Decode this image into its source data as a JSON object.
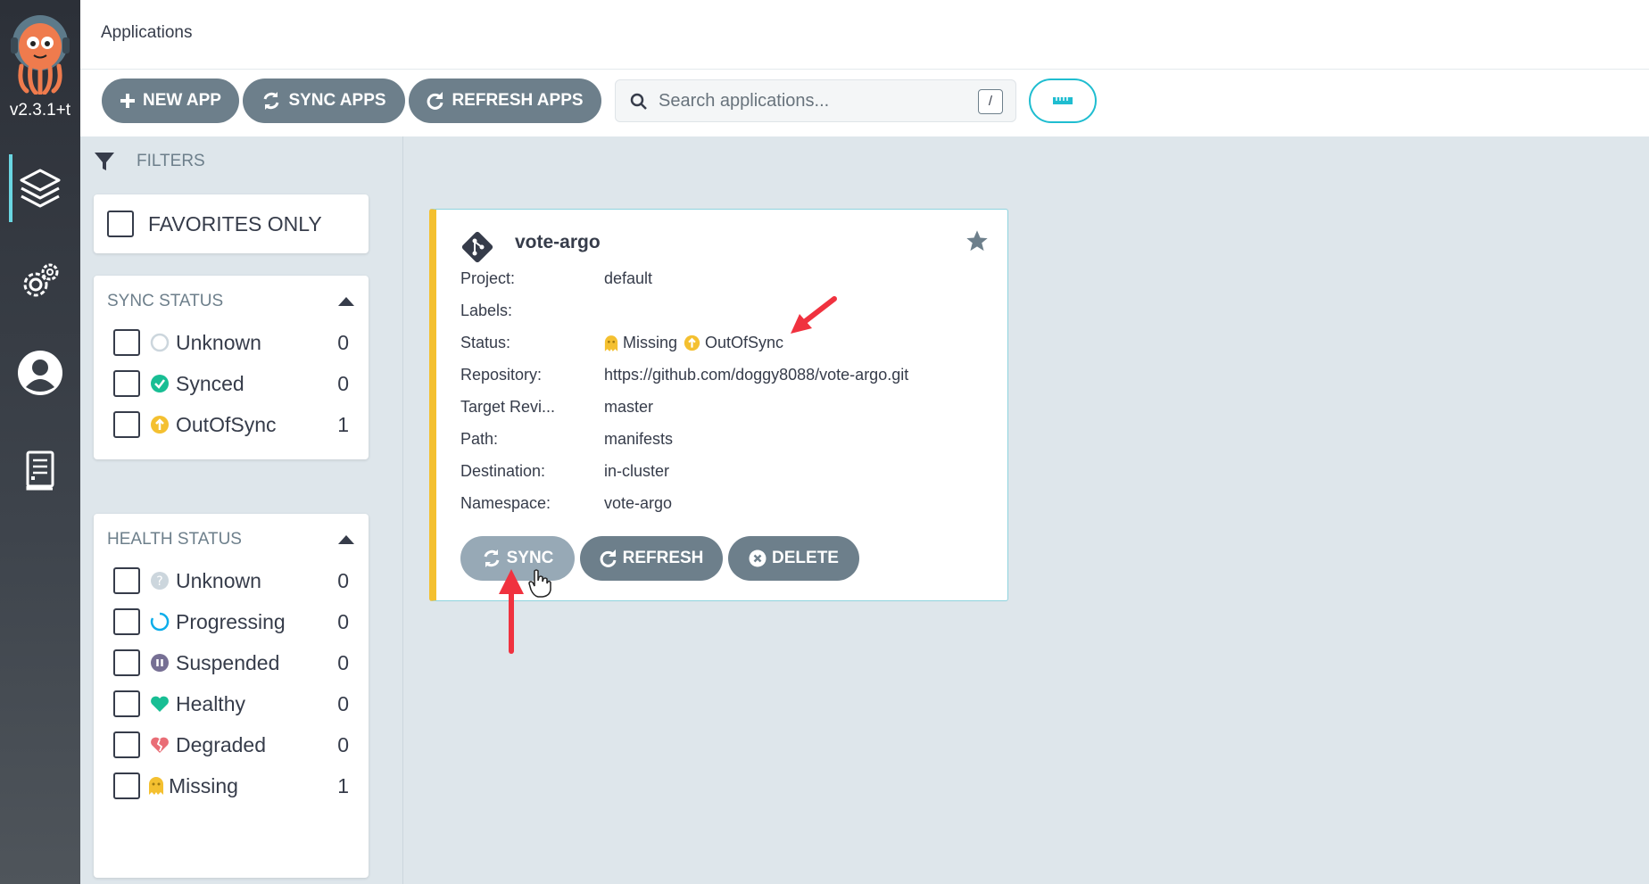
{
  "nav": {
    "version": "v2.3.1+t"
  },
  "header": {
    "title": "Applications"
  },
  "toolbar": {
    "new_app": "NEW APP",
    "sync_apps": "SYNC APPS",
    "refresh_apps": "REFRESH APPS",
    "search_placeholder": "Search applications...",
    "search_shortcut": "/"
  },
  "filters": {
    "title": "FILTERS",
    "favorites": "FAVORITES ONLY",
    "sync_status": {
      "title": "SYNC STATUS",
      "items": [
        {
          "label": "Unknown",
          "count": "0",
          "icon": "unknown-circle-icon"
        },
        {
          "label": "Synced",
          "count": "0",
          "icon": "check-circle-icon"
        },
        {
          "label": "OutOfSync",
          "count": "1",
          "icon": "arrow-up-circle-icon"
        }
      ]
    },
    "health_status": {
      "title": "HEALTH STATUS",
      "items": [
        {
          "label": "Unknown",
          "count": "0",
          "icon": "question-circle-icon"
        },
        {
          "label": "Progressing",
          "count": "0",
          "icon": "spinner-icon"
        },
        {
          "label": "Suspended",
          "count": "0",
          "icon": "pause-circle-icon"
        },
        {
          "label": "Healthy",
          "count": "0",
          "icon": "heart-icon"
        },
        {
          "label": "Degraded",
          "count": "0",
          "icon": "broken-heart-icon"
        },
        {
          "label": "Missing",
          "count": "1",
          "icon": "ghost-icon"
        }
      ]
    }
  },
  "app": {
    "name": "vote-argo",
    "fields": [
      {
        "key": "Project:",
        "value": "default"
      },
      {
        "key": "Labels:",
        "value": ""
      },
      {
        "key": "Status:",
        "health": "Missing",
        "sync": "OutOfSync"
      },
      {
        "key": "Repository:",
        "value": "https://github.com/doggy8088/vote-argo.git"
      },
      {
        "key": "Target Revi...",
        "value": "master"
      },
      {
        "key": "Path:",
        "value": "manifests"
      },
      {
        "key": "Destination:",
        "value": "in-cluster"
      },
      {
        "key": "Namespace:",
        "value": "vote-argo"
      }
    ],
    "actions": {
      "sync": "SYNC",
      "refresh": "REFRESH",
      "delete": "DELETE"
    }
  },
  "colors": {
    "accent": "#1fbdd0",
    "button": "#6d7f8b",
    "outofsync": "#f4c030",
    "synced": "#18be94",
    "annotation": "#f0323f"
  }
}
